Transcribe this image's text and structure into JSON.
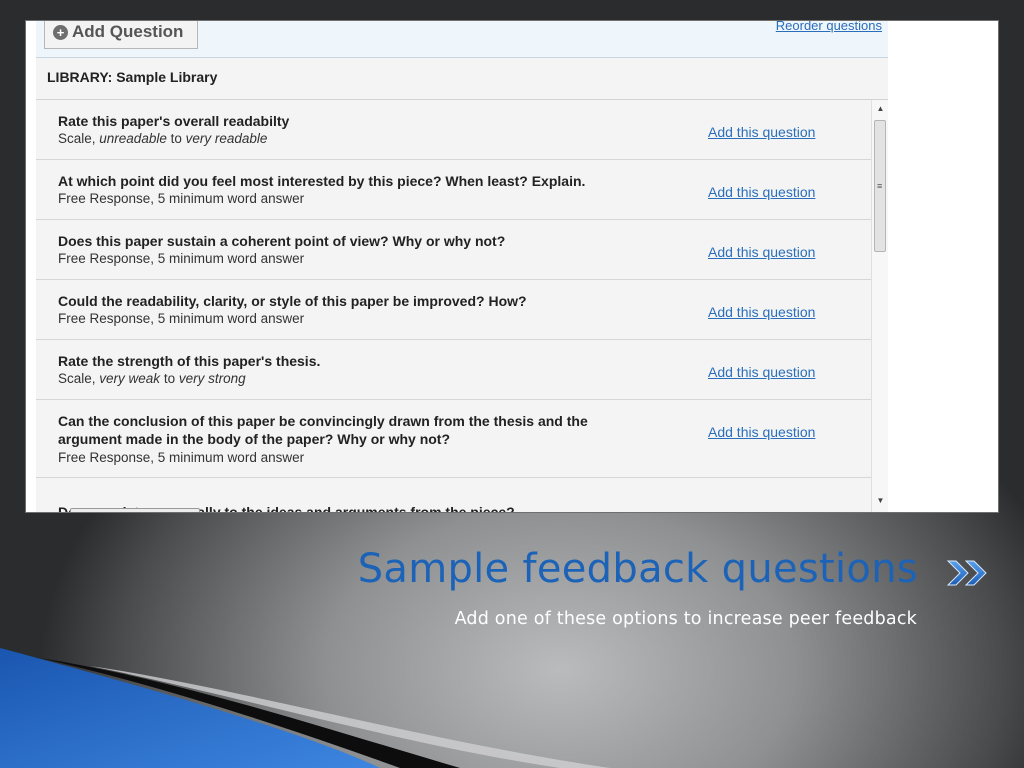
{
  "toolbar": {
    "add_question_label": "Add Question",
    "reorder_label": "Reorder questions"
  },
  "library": {
    "title": "LIBRARY: Sample Library"
  },
  "questions": [
    {
      "title": "Rate this paper's overall readabilty",
      "type": "Scale, ",
      "low": "unreadable",
      "mid": " to ",
      "high": "very readable",
      "action": "Add this question"
    },
    {
      "title": "At which point did you feel most interested by this piece? When least? Explain.",
      "sub": "Free Response, 5 minimum word answer",
      "action": "Add this question"
    },
    {
      "title": "Does this paper sustain a coherent point of view? Why or why not?",
      "sub": "Free Response, 5 minimum word answer",
      "action": "Add this question"
    },
    {
      "title": "Could the readability, clarity, or style of this paper be improved? How?",
      "sub": "Free Response, 5 minimum word answer",
      "action": "Add this question"
    },
    {
      "title": "Rate the strength of this paper's thesis.",
      "type": "Scale, ",
      "low": "very weak",
      "mid": " to ",
      "high": "very strong",
      "action": "Add this question"
    },
    {
      "title_line1": "Can the conclusion of this paper be convincingly drawn from the thesis and the",
      "title_line2": "argument made in the body of the paper? Why or why not?",
      "sub": "Free Response, 5 minimum word answer",
      "action": "Add this question"
    }
  ],
  "cut_off_row": "Do you relate personally to the ideas and arguments from the piece?",
  "slide": {
    "title": "Sample feedback questions",
    "subtitle": "Add one of these options to increase peer feedback"
  },
  "colors": {
    "accent": "#1c63b8",
    "link": "#2a6ebb"
  },
  "icons": [
    "plus-circle-icon",
    "scroll-up-arrow-icon",
    "scroll-down-arrow-icon",
    "double-chevron-right-icon"
  ]
}
